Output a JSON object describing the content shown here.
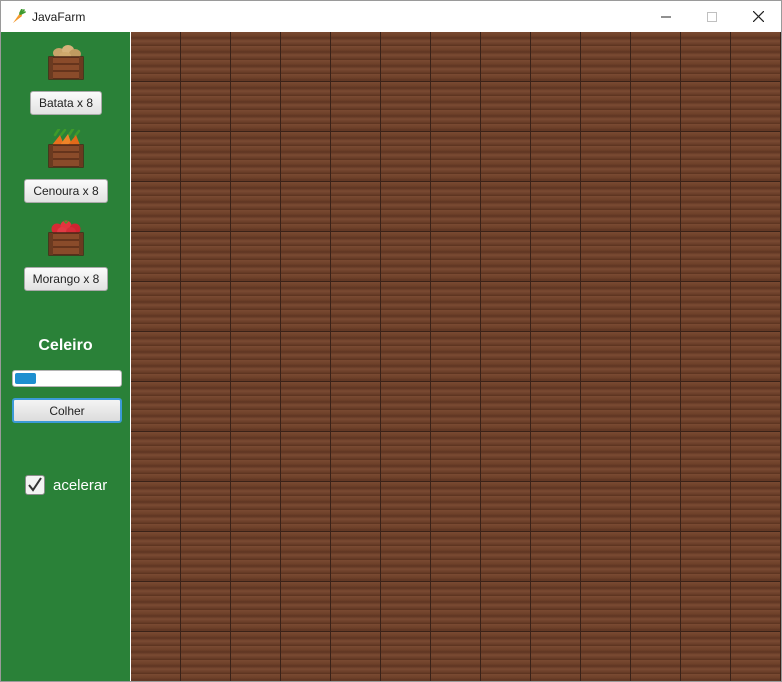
{
  "window": {
    "title": "JavaFarm",
    "controls": [
      "minimize",
      "maximize",
      "close"
    ]
  },
  "sidebar": {
    "crops": [
      {
        "name": "batata",
        "icon": "potato-crate-icon",
        "button_label": "Batata x 8"
      },
      {
        "name": "cenoura",
        "icon": "carrot-crate-icon",
        "button_label": "Cenoura x 8"
      },
      {
        "name": "morango",
        "icon": "strawberry-crate-icon",
        "button_label": "Morango x 8"
      }
    ],
    "celeiro": {
      "title": "Celeiro",
      "progress_fraction": 0.2,
      "harvest_label": "Colher"
    },
    "accelerate": {
      "label": "acelerar",
      "checked": true
    }
  },
  "field": {
    "tile": "soil-tile",
    "columns": 13,
    "rows": 13
  },
  "colors": {
    "sidebar": "#2a8138",
    "progress": "#1e8fd0",
    "focus": "#3c9ad7",
    "soil": "#6d4029"
  }
}
